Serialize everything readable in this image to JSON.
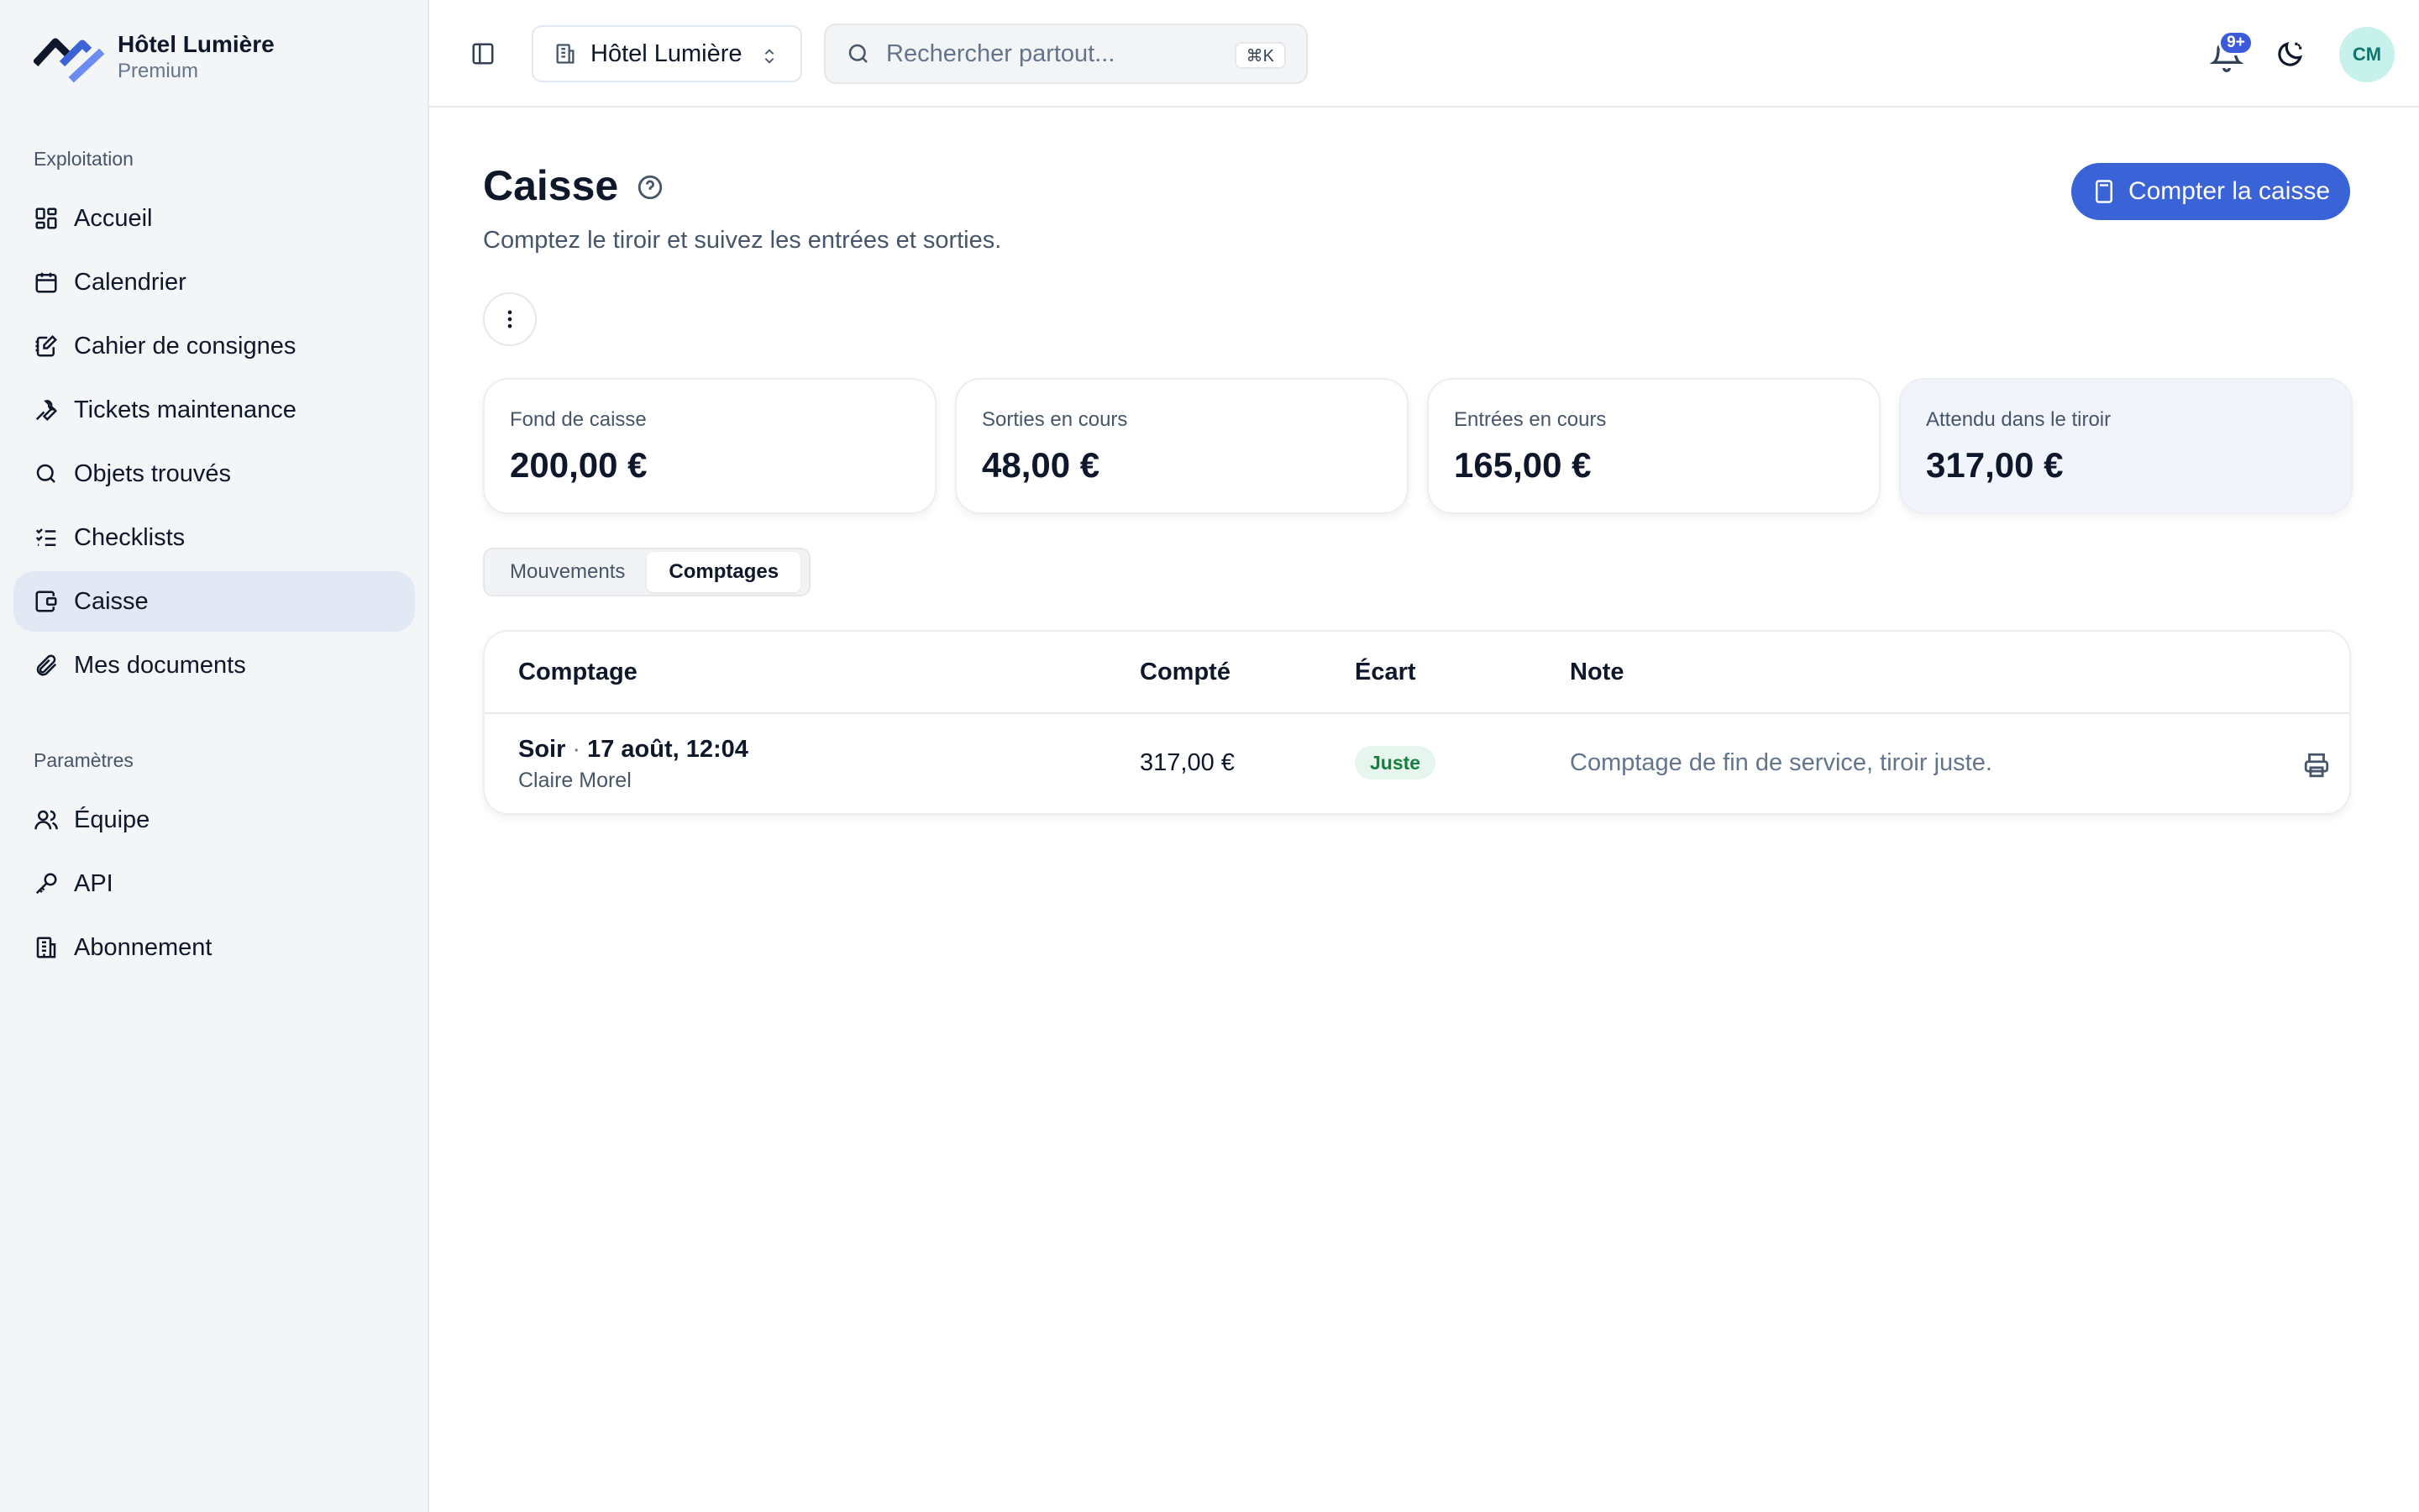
{
  "brand": {
    "name": "Hôtel Lumière",
    "plan": "Premium"
  },
  "sidebar": {
    "section_exploitation": "Exploitation",
    "section_parametres": "Paramètres",
    "items": [
      {
        "label": "Accueil",
        "icon": "dashboard-icon"
      },
      {
        "label": "Calendrier",
        "icon": "calendar-icon"
      },
      {
        "label": "Cahier de consignes",
        "icon": "notebook-icon"
      },
      {
        "label": "Tickets maintenance",
        "icon": "wrench-icon"
      },
      {
        "label": "Objets trouvés",
        "icon": "search-icon"
      },
      {
        "label": "Checklists",
        "icon": "checklist-icon"
      },
      {
        "label": "Caisse",
        "icon": "wallet-icon",
        "active": true
      },
      {
        "label": "Mes documents",
        "icon": "paperclip-icon"
      }
    ],
    "settings_items": [
      {
        "label": "Équipe",
        "icon": "users-icon"
      },
      {
        "label": "API",
        "icon": "key-icon"
      },
      {
        "label": "Abonnement",
        "icon": "building-icon"
      }
    ]
  },
  "topbar": {
    "hotel_select": "Hôtel Lumière",
    "search_placeholder": "Rechercher partout...",
    "search_shortcut": "⌘K",
    "notifications_badge": "9+",
    "avatar_initials": "CM"
  },
  "page": {
    "title": "Caisse",
    "subtitle": "Comptez le tiroir et suivez les entrées et sorties.",
    "primary_action": "Compter la caisse"
  },
  "stats": [
    {
      "label": "Fond de caisse",
      "value": "200,00 €"
    },
    {
      "label": "Sorties en cours",
      "value": "48,00 €"
    },
    {
      "label": "Entrées en cours",
      "value": "165,00 €"
    },
    {
      "label": "Attendu dans le tiroir",
      "value": "317,00 €"
    }
  ],
  "tabs": [
    {
      "label": "Mouvements"
    },
    {
      "label": "Comptages",
      "active": true
    }
  ],
  "table": {
    "columns": [
      "Comptage",
      "Compté",
      "Écart",
      "Note"
    ],
    "rows": [
      {
        "type": "Soir",
        "datetime": "17 août, 12:04",
        "person": "Claire Morel",
        "counted": "317,00 €",
        "gap": "Juste",
        "note": "Comptage de fin de service, tiroir juste."
      }
    ]
  },
  "colors": {
    "accent": "#3b63d8",
    "sidebar_bg": "#f4f5f7",
    "active_item_bg": "#e2e8f4",
    "success_bg": "#e6f6ee",
    "success_text": "#15803d"
  }
}
